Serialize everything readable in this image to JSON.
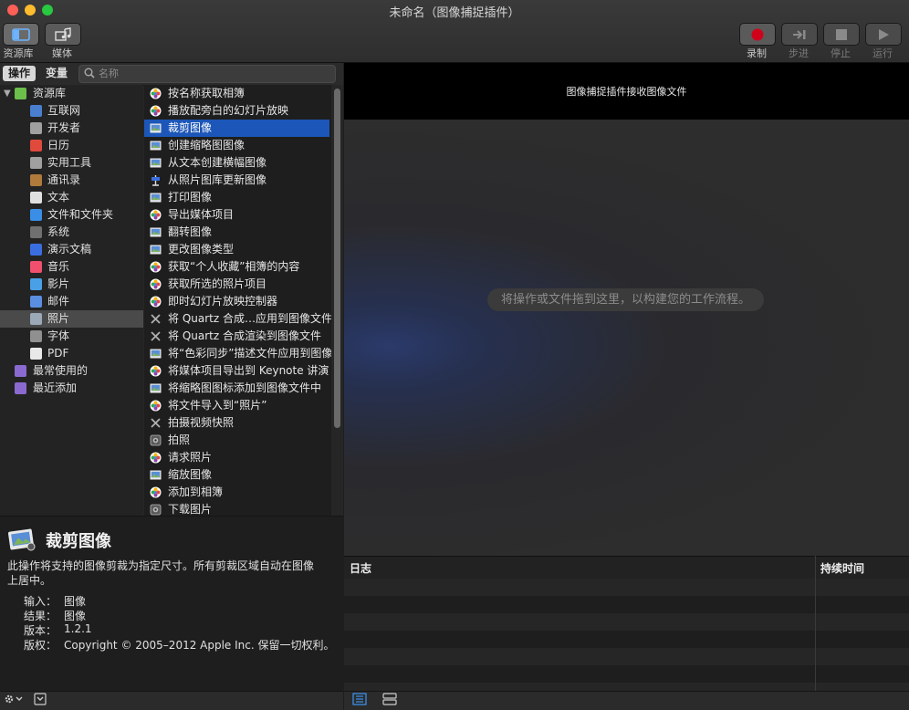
{
  "window": {
    "title": "未命名（图像捕捉插件）"
  },
  "toolbar": {
    "library_label": "资源库",
    "media_label": "媒体",
    "record_label": "录制",
    "step_label": "步进",
    "stop_label": "停止",
    "run_label": "运行"
  },
  "tabs": {
    "actions": "操作",
    "variables": "变量"
  },
  "search": {
    "placeholder": "名称",
    "value": ""
  },
  "library": {
    "items": [
      {
        "label": "资源库",
        "icon": "library-books-icon",
        "color": "#6bbf4a"
      },
      {
        "label": "互联网",
        "icon": "globe-icon",
        "color": "#4a7fd0"
      },
      {
        "label": "开发者",
        "icon": "tools-icon",
        "color": "#a0a0a0"
      },
      {
        "label": "日历",
        "icon": "calendar-icon",
        "color": "#e04a3c"
      },
      {
        "label": "实用工具",
        "icon": "tools-icon",
        "color": "#a0a0a0"
      },
      {
        "label": "通讯录",
        "icon": "contacts-icon",
        "color": "#b07a3c"
      },
      {
        "label": "文本",
        "icon": "text-doc-icon",
        "color": "#e0e0e0"
      },
      {
        "label": "文件和文件夹",
        "icon": "finder-icon",
        "color": "#3a8ee6"
      },
      {
        "label": "系统",
        "icon": "system-icon",
        "color": "#707070"
      },
      {
        "label": "演示文稿",
        "icon": "keynote-icon",
        "color": "#3a6ee0"
      },
      {
        "label": "音乐",
        "icon": "music-icon",
        "color": "#f0506e"
      },
      {
        "label": "影片",
        "icon": "movie-icon",
        "color": "#4aa0e6"
      },
      {
        "label": "邮件",
        "icon": "mail-icon",
        "color": "#5a8ee0"
      },
      {
        "label": "照片",
        "icon": "photos-icon",
        "color": "#9aa8b8"
      },
      {
        "label": "字体",
        "icon": "font-icon",
        "color": "#909090"
      },
      {
        "label": "PDF",
        "icon": "pdf-icon",
        "color": "#e8e8e8"
      },
      {
        "label": "最常使用的",
        "icon": "smart-folder-icon",
        "color": "#8a6ad0"
      },
      {
        "label": "最近添加",
        "icon": "smart-folder-icon",
        "color": "#8a6ad0"
      }
    ],
    "selected_index": 13
  },
  "actions": {
    "items": [
      {
        "label": "按名称获取相簿",
        "icon": "photos-app-icon"
      },
      {
        "label": "播放配旁白的幻灯片放映",
        "icon": "photos-app-icon"
      },
      {
        "label": "裁剪图像",
        "icon": "preview-image-icon"
      },
      {
        "label": "创建缩略图图像",
        "icon": "preview-image-icon"
      },
      {
        "label": "从文本创建横幅图像",
        "icon": "preview-image-icon"
      },
      {
        "label": "从照片图库更新图像",
        "icon": "keynote-icon"
      },
      {
        "label": "打印图像",
        "icon": "preview-image-icon"
      },
      {
        "label": "导出媒体项目",
        "icon": "photos-app-icon"
      },
      {
        "label": "翻转图像",
        "icon": "preview-image-icon"
      },
      {
        "label": "更改图像类型",
        "icon": "preview-image-icon"
      },
      {
        "label": "获取“个人收藏”相簿的内容",
        "icon": "photos-app-icon"
      },
      {
        "label": "获取所选的照片项目",
        "icon": "photos-app-icon"
      },
      {
        "label": "即时幻灯片放映控制器",
        "icon": "photos-app-icon"
      },
      {
        "label": "将 Quartz 合成…应用到图像文件",
        "icon": "tools-icon"
      },
      {
        "label": "将 Quartz 合成渲染到图像文件",
        "icon": "tools-icon"
      },
      {
        "label": "将“色彩同步”描述文件应用到图像",
        "icon": "preview-image-icon"
      },
      {
        "label": "将媒体项目导出到 Keynote 讲演",
        "icon": "photos-app-icon"
      },
      {
        "label": "将缩略图图标添加到图像文件中",
        "icon": "preview-image-icon"
      },
      {
        "label": "将文件导入到“照片”",
        "icon": "photos-app-icon"
      },
      {
        "label": "拍摄视频快照",
        "icon": "tools-icon"
      },
      {
        "label": "拍照",
        "icon": "camera-icon"
      },
      {
        "label": "请求照片",
        "icon": "photos-app-icon"
      },
      {
        "label": "缩放图像",
        "icon": "preview-image-icon"
      },
      {
        "label": "添加到相簿",
        "icon": "photos-app-icon"
      },
      {
        "label": "下载图片",
        "icon": "camera-icon"
      }
    ],
    "selected_index": 2
  },
  "description": {
    "title": "裁剪图像",
    "text": "此操作将支持的图像剪裁为指定尺寸。所有剪裁区域自动在图像上居中。",
    "meta": [
      {
        "key": "输入：",
        "value": "图像"
      },
      {
        "key": "结果：",
        "value": "图像"
      },
      {
        "key": "版本：",
        "value": "1.2.1"
      },
      {
        "key": "版权：",
        "value": "Copyright © 2005–2012 Apple Inc. 保留一切权利。"
      }
    ]
  },
  "workflow": {
    "header_text": "图像捕捉插件接收图像文件",
    "drop_hint": "将操作或文件拖到这里，以构建您的工作流程。"
  },
  "log": {
    "col_log": "日志",
    "col_duration": "持续时间"
  },
  "colors": {
    "accent": "#1c56b8",
    "record": "#d0021b"
  }
}
